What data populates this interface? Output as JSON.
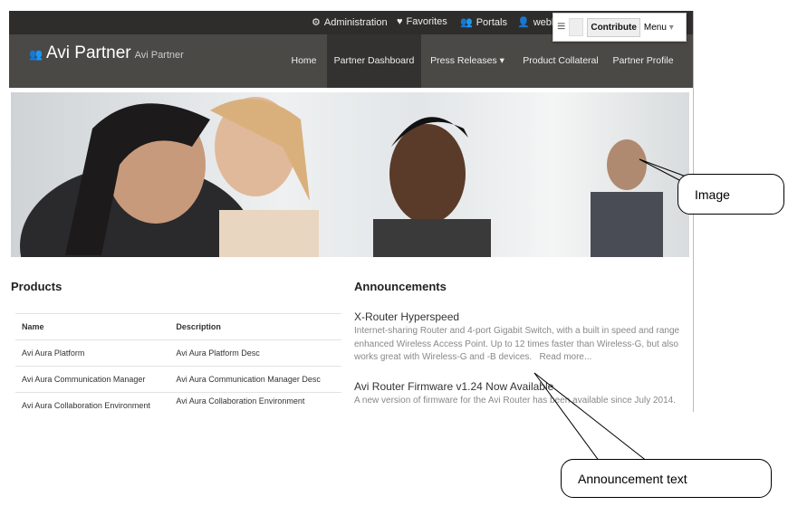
{
  "topbar": {
    "items": [
      {
        "icon": "gears-icon",
        "label": "Administration"
      },
      {
        "icon": "heart-icon",
        "label": "Favorites"
      },
      {
        "icon": "users-icon",
        "label": "Portals"
      },
      {
        "icon": "user-icon",
        "label": "weblo"
      }
    ]
  },
  "toolbar": {
    "contribute": "Contribute",
    "menu": "Menu"
  },
  "header": {
    "title": "Avi Partner",
    "subtitle": "Avi Partner"
  },
  "nav": {
    "items": [
      {
        "label": "Home"
      },
      {
        "label": "Partner Dashboard",
        "active": true
      },
      {
        "label": "Press Releases",
        "dropdown": true
      },
      {
        "label": "Product Collateral"
      },
      {
        "label": "Partner Profile"
      }
    ]
  },
  "products": {
    "title": "Products",
    "columns": [
      "Name",
      "Description"
    ],
    "rows": [
      [
        "Avi Aura Platform",
        "Avi Aura Platform Desc"
      ],
      [
        "Avi Aura Communication Manager",
        "Avi Aura Communication Manager Desc"
      ],
      [
        "Avi Aura Collaboration Environment",
        "Avi Aura Collaboration Environment"
      ]
    ]
  },
  "announcements": {
    "title": "Announcements",
    "items": [
      {
        "title": "X-Router Hyperspeed",
        "body": "Internet-sharing Router and 4-port Gigabit Switch, with a built in speed and range enhanced Wireless Access Point. Up to 12 times faster than Wireless-G, but also works great with Wireless-G and -B devices.",
        "more": "Read more..."
      },
      {
        "title": "Avi Router Firmware v1.24 Now Available",
        "body": "A new version of firmware for the Avi Router has been available since July 2014."
      }
    ]
  },
  "callouts": {
    "image": "Image",
    "announcement": "Announcement text"
  }
}
